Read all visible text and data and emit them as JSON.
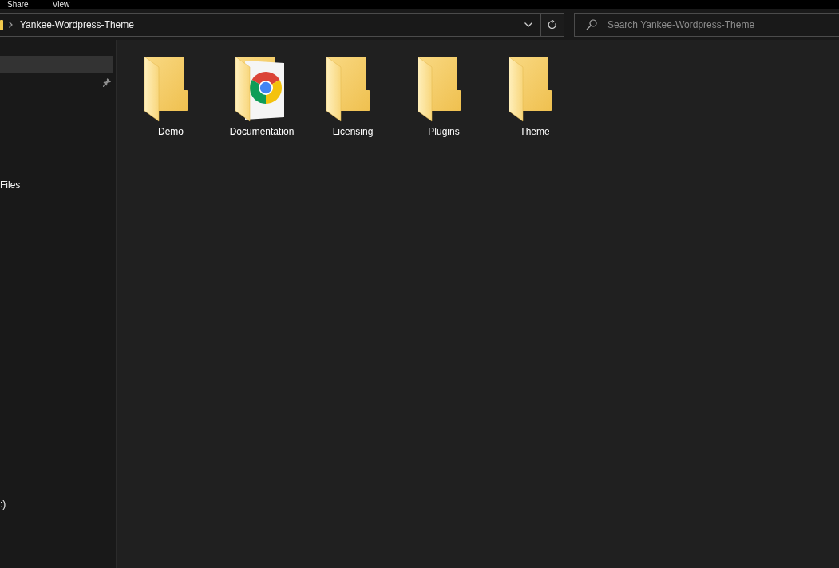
{
  "ribbon": {
    "tabs": [
      {
        "label": "Share",
        "selected": false
      },
      {
        "label": "View",
        "selected": false
      }
    ]
  },
  "address_bar": {
    "breadcrumbs": [
      {
        "label": "Yankee-Wordpress-Theme"
      }
    ]
  },
  "search": {
    "placeholder": "Search Yankee-Wordpress-Theme"
  },
  "nav_pane": {
    "sections": [
      {
        "items": [
          {
            "selected": true,
            "pinned": false
          },
          {
            "selected": false,
            "pinned": true
          }
        ]
      },
      {
        "items": [
          {
            "label": "Files",
            "selected": false,
            "pinned": false
          }
        ]
      },
      {
        "items": [
          {
            "label": ":)",
            "selected": false,
            "pinned": false
          }
        ]
      }
    ]
  },
  "files": [
    {
      "name": "Demo",
      "kind": "folder"
    },
    {
      "name": "Documentation",
      "kind": "folder_document"
    },
    {
      "name": "Licensing",
      "kind": "folder"
    },
    {
      "name": "Plugins",
      "kind": "folder"
    },
    {
      "name": "Theme",
      "kind": "folder"
    }
  ]
}
